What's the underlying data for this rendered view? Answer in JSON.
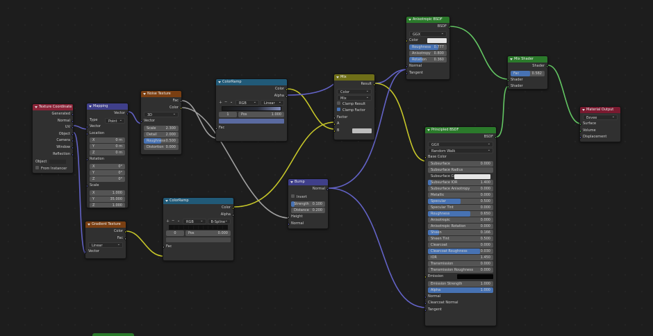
{
  "nodes": {
    "texcoord": {
      "title": "Texture Coordinate",
      "outputs": [
        "Generated",
        "Normal",
        "UV",
        "Object",
        "Camera",
        "Window",
        "Reflection"
      ],
      "object_label": "Object",
      "from_instancer": "From Instancer"
    },
    "mapping": {
      "title": "Mapping",
      "out": "Vector",
      "type_label": "Type",
      "type_value": "Point",
      "vector": "Vector",
      "location": "Location",
      "rotation": "Rotation",
      "scale": "Scale",
      "loc": [
        {
          "a": "X",
          "v": "0 m"
        },
        {
          "a": "Y",
          "v": "0 m"
        },
        {
          "a": "Z",
          "v": "0 m"
        }
      ],
      "rot": [
        {
          "a": "X",
          "v": "0°"
        },
        {
          "a": "Y",
          "v": "0°"
        },
        {
          "a": "Z",
          "v": "0°"
        }
      ],
      "scl": [
        {
          "a": "X",
          "v": "1.000"
        },
        {
          "a": "Y",
          "v": "35.000"
        },
        {
          "a": "Z",
          "v": "1.000"
        }
      ]
    },
    "noise": {
      "title": "Noise Texture",
      "fac": "Fac",
      "color": "Color",
      "dim": "3D",
      "vector": "Vector",
      "fields": [
        {
          "l": "Scale",
          "v": "2.300"
        },
        {
          "l": "Detail",
          "v": "2.000"
        },
        {
          "l": "Roughness",
          "v": "0.500"
        },
        {
          "l": "Distortion",
          "v": "0.000"
        }
      ]
    },
    "ramp1": {
      "title": "ColorRamp",
      "color": "Color",
      "alpha": "Alpha",
      "mode": "RGB",
      "interp": "Linear",
      "index": "1",
      "pos_label": "Pos",
      "pos": "1.000",
      "fac": "Fac"
    },
    "gradient": {
      "title": "Gradient Texture",
      "color": "Color",
      "fac": "Fac",
      "type": "Linear",
      "vector": "Vector"
    },
    "ramp2": {
      "title": "ColorRamp",
      "color": "Color",
      "alpha": "Alpha",
      "mode": "RGB",
      "interp": "B-Spline",
      "index": "0",
      "pos_label": "Pos",
      "pos": "0.000",
      "fac": "Fac"
    },
    "bump": {
      "title": "Bump",
      "normal_out": "Normal",
      "invert": "Invert",
      "strength_l": "Strength",
      "strength": "0.100",
      "distance_l": "Distance",
      "distance": "0.200",
      "height": "Height",
      "normal_in": "Normal"
    },
    "mix": {
      "title": "Mix",
      "result": "Result",
      "dtype": "Color",
      "blend": "Mix",
      "clamp_result": "Clamp Result",
      "clamp_factor": "Clamp Factor",
      "factor": "Factor",
      "a": "A",
      "b": "B"
    },
    "aniso": {
      "title": "Anisotropic BSDF",
      "bsdf": "BSDF",
      "dist": "GGX",
      "color": "Color",
      "roughness_l": "Roughness",
      "roughness": "0.777",
      "anisotropy_l": "Anisotropy",
      "anisotropy": "0.800",
      "rotation_l": "Rotation",
      "rotation": "0.360",
      "normal": "Normal",
      "tangent": "Tangent"
    },
    "mixshader": {
      "title": "Mix Shader",
      "shader_out": "Shader",
      "fac_l": "Fac",
      "fac": "0.582",
      "shader1": "Shader",
      "shader2": "Shader"
    },
    "output": {
      "title": "Material Output",
      "target": "Eevee",
      "surface": "Surface",
      "volume": "Volume",
      "displacement": "Displacement"
    },
    "principled": {
      "title": "Principled BSDF",
      "bsdf": "BSDF",
      "dist": "GGX",
      "sss": "Random Walk",
      "base_color": "Base Color",
      "fields": [
        {
          "l": "Subsurface",
          "v": "0.000",
          "f": 0
        },
        {
          "l": "Subsurface Radius",
          "v": "",
          "f": 0
        },
        {
          "l": "Subsurface Color",
          "v": "",
          "f": 0,
          "swatch": true
        },
        {
          "l": "Subsurface IOR",
          "v": "1.400",
          "f": 0.05
        },
        {
          "l": "Subsurface Anisotropy",
          "v": "0.000",
          "f": 0
        },
        {
          "l": "Metallic",
          "v": "0.000",
          "f": 0
        },
        {
          "l": "Specular",
          "v": "0.500",
          "f": 0.5
        },
        {
          "l": "Specular Tint",
          "v": "0.000",
          "f": 0
        },
        {
          "l": "Roughness",
          "v": "0.650",
          "f": 0.65
        },
        {
          "l": "Anisotropic",
          "v": "0.000",
          "f": 0
        },
        {
          "l": "Anisotropic Rotation",
          "v": "0.000",
          "f": 0
        },
        {
          "l": "Sheen",
          "v": "0.166",
          "f": 0.166
        },
        {
          "l": "Sheen Tint",
          "v": "0.500",
          "f": 0
        },
        {
          "l": "Clearcoat",
          "v": "0.000",
          "f": 0
        },
        {
          "l": "Clearcoat Roughness",
          "v": "0.030",
          "f": 0.8
        },
        {
          "l": "IOR",
          "v": "1.450",
          "f": 0
        },
        {
          "l": "Transmission",
          "v": "0.000",
          "f": 0
        },
        {
          "l": "Transmission Roughness",
          "v": "0.000",
          "f": 0
        }
      ],
      "emission": "Emission",
      "emission_strength_l": "Emission Strength",
      "emission_strength": "1.000",
      "alpha_l": "Alpha",
      "alpha": "1.000",
      "normal": "Normal",
      "clearcoat_normal": "Clearcoat Normal",
      "tangent": "Tangent"
    }
  },
  "colors": {
    "texture_header": "#7a3f12",
    "converter_header": "#215a78",
    "vector_header": "#3f3f8a",
    "shader_header": "#2b7a2b",
    "link_color": "#c7c729",
    "link_vector": "#6363c7",
    "link_float": "#a1a1a1",
    "link_shader": "#63c763"
  }
}
